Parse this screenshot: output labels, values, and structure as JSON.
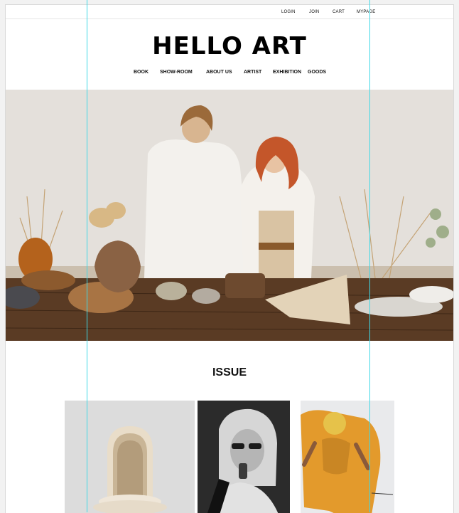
{
  "topbar": {
    "links": [
      "LOGIN",
      "JOIN",
      "CART",
      "MYPAGE"
    ]
  },
  "brand": {
    "logo": "HELLO ART"
  },
  "nav": {
    "items": [
      "BOOK",
      "SHOW-ROOM",
      "ABOUT US",
      "ARTIST",
      "EXHIBITION",
      "GOODS"
    ]
  },
  "sections": {
    "issue_title": "ISSUE"
  },
  "colors": {
    "guide": "#3fd8e6",
    "text": "#111111",
    "background": "#ffffff"
  }
}
